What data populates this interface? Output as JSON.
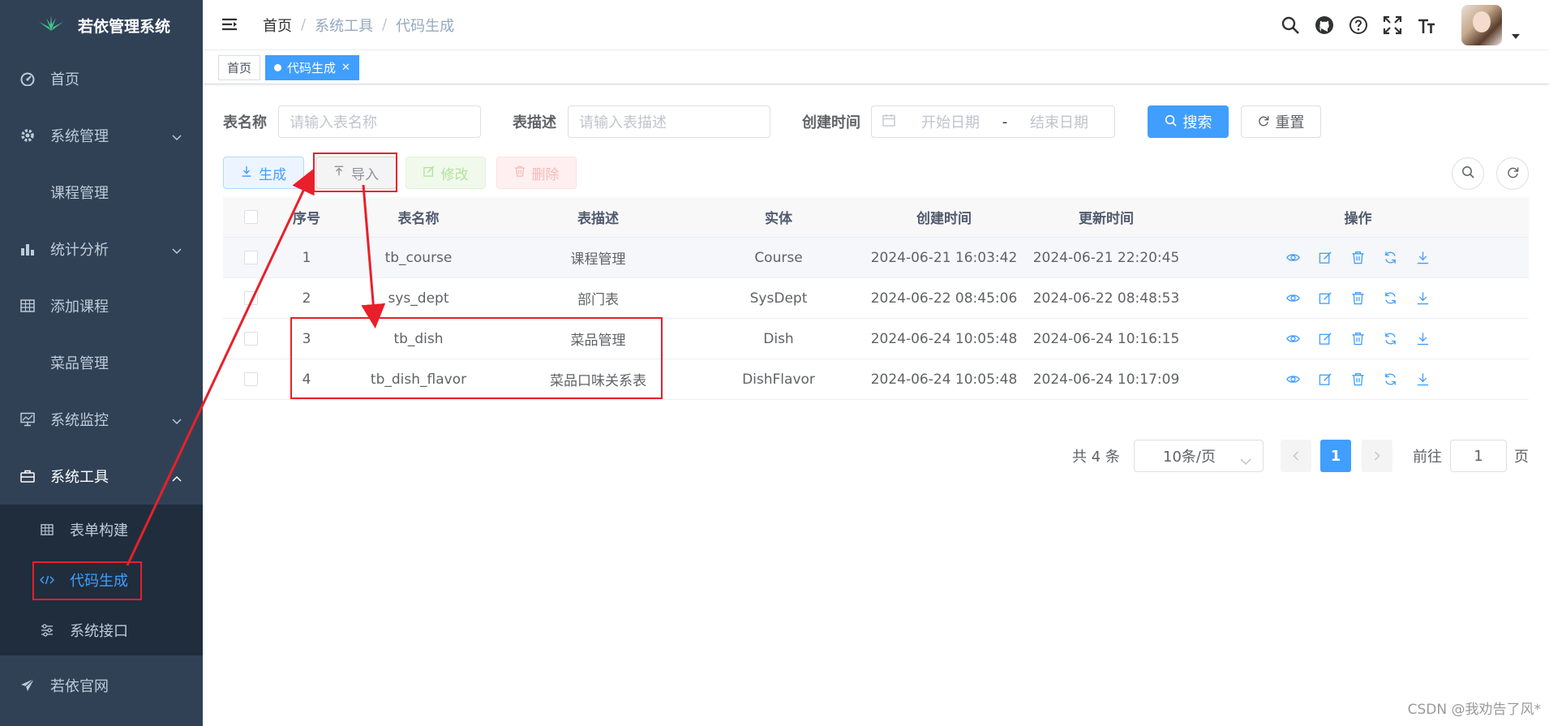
{
  "app": {
    "title": "若依管理系统"
  },
  "sidebar": {
    "items": [
      {
        "label": "首页",
        "icon": "dashboard-icon"
      },
      {
        "label": "系统管理",
        "icon": "gear-icon"
      },
      {
        "label": "课程管理",
        "icon": ""
      },
      {
        "label": "统计分析",
        "icon": "bar-chart-icon"
      },
      {
        "label": "添加课程",
        "icon": "table-icon"
      },
      {
        "label": "菜品管理",
        "icon": ""
      },
      {
        "label": "系统监控",
        "icon": "monitor-icon"
      },
      {
        "label": "系统工具",
        "icon": "toolbox-icon"
      }
    ],
    "tools_submenu": [
      {
        "label": "表单构建",
        "icon": "table-icon"
      },
      {
        "label": "代码生成",
        "icon": "code-icon"
      },
      {
        "label": "系统接口",
        "icon": "sliders-icon"
      }
    ],
    "external": {
      "label": "若依官网",
      "icon": "paper-plane-icon"
    }
  },
  "header": {
    "breadcrumb": [
      "首页",
      "系统工具",
      "代码生成"
    ]
  },
  "tags": [
    {
      "label": "首页"
    },
    {
      "label": "代码生成"
    }
  ],
  "search": {
    "table_name_label": "表名称",
    "table_name_placeholder": "请输入表名称",
    "table_desc_label": "表描述",
    "table_desc_placeholder": "请输入表描述",
    "create_time_label": "创建时间",
    "start_placeholder": "开始日期",
    "range_separator": "-",
    "end_placeholder": "结束日期",
    "search_button": "搜索",
    "reset_button": "重置"
  },
  "toolbar": {
    "generate": "生成",
    "import": "导入",
    "edit": "修改",
    "delete": "删除"
  },
  "table": {
    "columns": [
      "序号",
      "表名称",
      "表描述",
      "实体",
      "创建时间",
      "更新时间",
      "操作"
    ],
    "rows": [
      {
        "no": "1",
        "name": "tb_course",
        "desc": "课程管理",
        "entity": "Course",
        "created": "2024-06-21 16:03:42",
        "updated": "2024-06-21 22:20:45"
      },
      {
        "no": "2",
        "name": "sys_dept",
        "desc": "部门表",
        "entity": "SysDept",
        "created": "2024-06-22 08:45:06",
        "updated": "2024-06-22 08:48:53"
      },
      {
        "no": "3",
        "name": "tb_dish",
        "desc": "菜品管理",
        "entity": "Dish",
        "created": "2024-06-24 10:05:48",
        "updated": "2024-06-24 10:16:15"
      },
      {
        "no": "4",
        "name": "tb_dish_flavor",
        "desc": "菜品口味关系表",
        "entity": "DishFlavor",
        "created": "2024-06-24 10:05:48",
        "updated": "2024-06-24 10:17:09"
      }
    ]
  },
  "pagination": {
    "total": "共 4 条",
    "page_size": "10条/页",
    "current_page": "1",
    "goto_label": "前往",
    "goto_value": "1",
    "page_suffix": "页"
  },
  "watermark": "CSDN @我劝告了风*",
  "colors": {
    "primary": "#409eff",
    "sidebar_bg": "#304156",
    "annotation": "#e8202a"
  }
}
